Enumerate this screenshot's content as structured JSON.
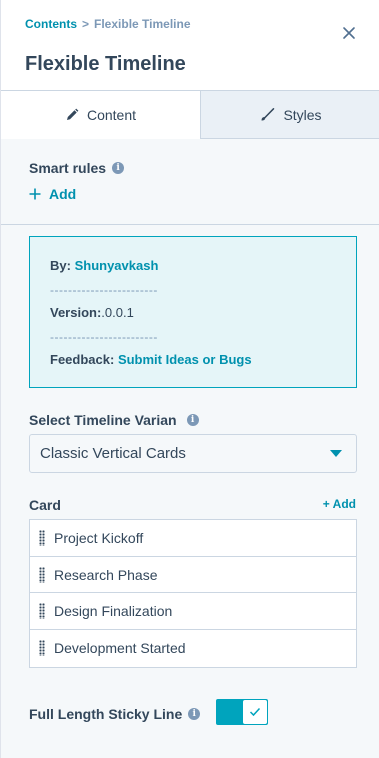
{
  "breadcrumb": {
    "parent": "Contents",
    "separator": ">",
    "current": "Flexible Timeline"
  },
  "header": {
    "title": "Flexible Timeline"
  },
  "tabs": [
    {
      "label": "Content"
    },
    {
      "label": "Styles"
    }
  ],
  "smart_rules": {
    "label": "Smart rules",
    "add_label": "Add"
  },
  "info_box": {
    "by_label": "By:",
    "author": "Shunyavkash",
    "divider": "------------------------",
    "version_label": "Version:",
    "version": ".0.0.1",
    "feedback_label": "Feedback:",
    "feedback_link": "Submit Ideas or Bugs"
  },
  "timeline_variant": {
    "label": "Select Timeline Varian",
    "selected": "Classic Vertical Cards"
  },
  "cards": {
    "label": "Card",
    "add_label": "+ Add",
    "items": [
      {
        "label": "Project Kickoff"
      },
      {
        "label": "Research Phase"
      },
      {
        "label": "Design Finalization"
      },
      {
        "label": "Development Started"
      }
    ]
  },
  "sticky_line": {
    "label": "Full Length Sticky Line",
    "enabled": true
  },
  "colors": {
    "accent": "#0091ae",
    "toggle": "#00a4bd",
    "info_bg": "#e5f5f8",
    "text": "#33475b"
  }
}
